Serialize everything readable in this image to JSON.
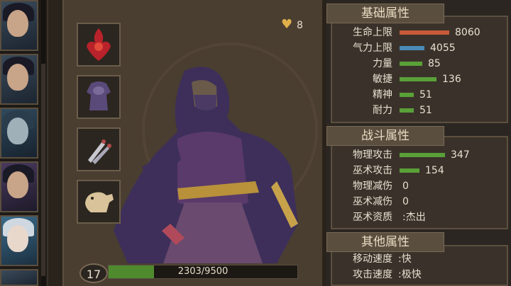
{
  "resources": {
    "heart_count": "8"
  },
  "character": {
    "level": "17",
    "exp_text": "2303/9500",
    "exp_fraction": 0.242
  },
  "colors": {
    "hp": "#c85a3a",
    "stamina": "#4a8ab8",
    "stat": "#5aa038",
    "attack": "#5aa038"
  },
  "equipment_slots": [
    {
      "name": "emblem-slot",
      "icon": "red-emblem-icon"
    },
    {
      "name": "armor-slot",
      "icon": "purple-armor-icon"
    },
    {
      "name": "weapon-slot",
      "icon": "throwing-knives-icon"
    },
    {
      "name": "mount-slot",
      "icon": "camel-icon"
    }
  ],
  "basic_attrs": {
    "title": "基础属性",
    "rows": [
      {
        "label": "生命上限",
        "value": "8060",
        "bar": 1.0,
        "color": "#c85a3a"
      },
      {
        "label": "气力上限",
        "value": "4055",
        "bar": 0.5,
        "color": "#4a8ab8"
      },
      {
        "label": "力量",
        "value": "85",
        "bar": 0.46,
        "color": "#5aa038"
      },
      {
        "label": "敏捷",
        "value": "136",
        "bar": 0.74,
        "color": "#5aa038"
      },
      {
        "label": "精神",
        "value": "51",
        "bar": 0.28,
        "color": "#5aa038"
      },
      {
        "label": "耐力",
        "value": "51",
        "bar": 0.28,
        "color": "#5aa038"
      }
    ]
  },
  "combat_attrs": {
    "title": "战斗属性",
    "rows": [
      {
        "label": "物理攻击",
        "value": "347",
        "bar": 0.84,
        "color": "#5aa038"
      },
      {
        "label": "巫术攻击",
        "value": "154",
        "bar": 0.37,
        "color": "#5aa038"
      },
      {
        "label": "物理减伤",
        "value": "0",
        "bar": 0
      },
      {
        "label": "巫术减伤",
        "value": "0",
        "bar": 0
      },
      {
        "label": "巫术资质",
        "value": ":杰出",
        "bar": 0
      }
    ]
  },
  "other_attrs": {
    "title": "其他属性",
    "rows": [
      {
        "label": "移动速度",
        "value": ":快"
      },
      {
        "label": "攻击速度",
        "value": ":极快"
      }
    ]
  }
}
